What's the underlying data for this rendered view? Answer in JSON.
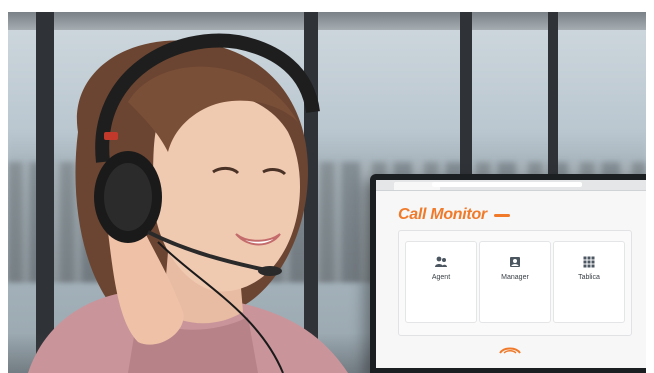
{
  "app": {
    "logo": "Call Monitor"
  },
  "cards": [
    {
      "label": "Agent",
      "icon": "users-icon"
    },
    {
      "label": "Manager",
      "icon": "person-badge-icon"
    },
    {
      "label": "Tablica",
      "icon": "grid-icon"
    }
  ],
  "colors": {
    "brand": "#f07a2a",
    "screen_bg": "#f7f7f7",
    "monitor_bezel": "#1c1f22"
  }
}
